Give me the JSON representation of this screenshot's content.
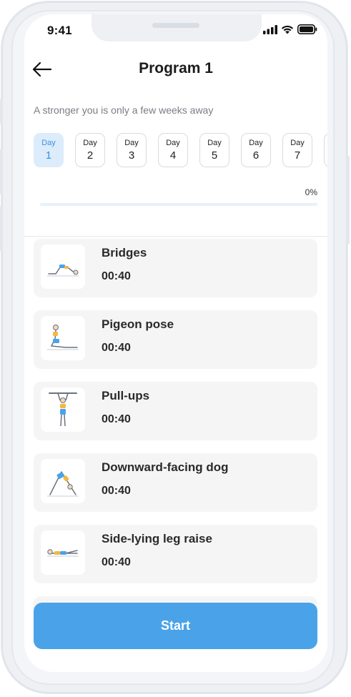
{
  "status_bar": {
    "time": "9:41"
  },
  "header": {
    "title": "Program 1"
  },
  "subtitle": "A stronger you is only a few weeks away",
  "days": [
    {
      "label": "Day",
      "number": "1",
      "active": true
    },
    {
      "label": "Day",
      "number": "2",
      "active": false
    },
    {
      "label": "Day",
      "number": "3",
      "active": false
    },
    {
      "label": "Day",
      "number": "4",
      "active": false
    },
    {
      "label": "Day",
      "number": "5",
      "active": false
    },
    {
      "label": "Day",
      "number": "6",
      "active": false
    },
    {
      "label": "Day",
      "number": "7",
      "active": false
    }
  ],
  "progress": {
    "text": "0%",
    "value": 0
  },
  "exercises": [
    {
      "name": "Bridges",
      "duration": "00:40",
      "icon": "bridges-illustration"
    },
    {
      "name": "Pigeon pose",
      "duration": "00:40",
      "icon": "pigeon-pose-illustration"
    },
    {
      "name": "Pull-ups",
      "duration": "00:40",
      "icon": "pull-ups-illustration"
    },
    {
      "name": "Downward-facing dog",
      "duration": "00:40",
      "icon": "downward-dog-illustration"
    },
    {
      "name": "Side-lying leg raise",
      "duration": "00:40",
      "icon": "side-leg-raise-illustration"
    }
  ],
  "start_button": {
    "label": "Start"
  },
  "colors": {
    "accent": "#4aa3e8",
    "active_day_bg": "#dcecfb",
    "card_bg": "#f5f5f6"
  }
}
